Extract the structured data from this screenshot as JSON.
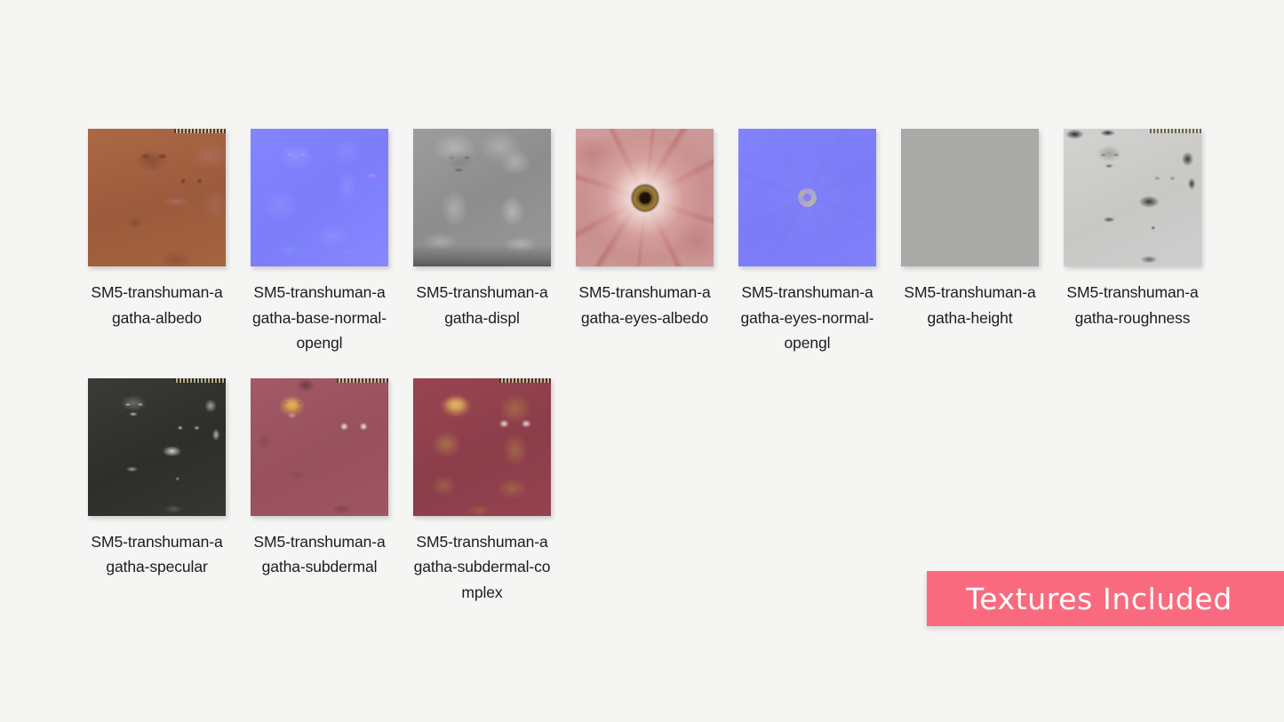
{
  "page": {
    "background_color": "#f5f5f4",
    "title": "Texture set preview sheet"
  },
  "textures": [
    {
      "label": "SM5-transhuman-agatha-albedo",
      "map_type": "albedo",
      "style": "tex-albedo",
      "has_strip": true,
      "dominant_color": "#a3603f"
    },
    {
      "label": "SM5-transhuman-agatha-base-normal-opengl",
      "map_type": "base-normal-opengl",
      "style": "tex-normal",
      "has_strip": false,
      "dominant_color": "#8080ff"
    },
    {
      "label": "SM5-transhuman-agatha-displ",
      "map_type": "displacement",
      "style": "tex-displ",
      "has_strip": false,
      "dominant_color": "#949494"
    },
    {
      "label": "SM5-transhuman-agatha-eyes-albedo",
      "map_type": "eyes-albedo",
      "style": "tex-eyes-albedo",
      "has_strip": false,
      "dominant_color": "#cf9b99"
    },
    {
      "label": "SM5-transhuman-agatha-eyes-normal-opengl",
      "map_type": "eyes-normal-opengl",
      "style": "tex-eyes-normal",
      "has_strip": false,
      "dominant_color": "#7f7ffb"
    },
    {
      "label": "SM5-transhuman-agatha-height",
      "map_type": "height",
      "style": "tex-height",
      "has_strip": false,
      "dominant_color": "#aaaaa8"
    },
    {
      "label": "SM5-transhuman-agatha-roughness",
      "map_type": "roughness",
      "style": "tex-rough",
      "has_strip": true,
      "dominant_color": "#cdcdcb"
    },
    {
      "label": "SM5-transhuman-agatha-specular",
      "map_type": "specular",
      "style": "tex-spec",
      "has_strip": true,
      "dominant_color": "#333331"
    },
    {
      "label": "SM5-transhuman-agatha-subdermal",
      "map_type": "subdermal",
      "style": "tex-sub",
      "has_strip": true,
      "dominant_color": "#9e5460"
    },
    {
      "label": "SM5-transhuman-agatha-subdermal-complex",
      "map_type": "subdermal-complex",
      "style": "tex-subc",
      "has_strip": true,
      "dominant_color": "#93414e"
    }
  ],
  "banner": {
    "text": "Textures Included",
    "background_color": "#fa6a7e",
    "text_color": "#ffffff"
  }
}
